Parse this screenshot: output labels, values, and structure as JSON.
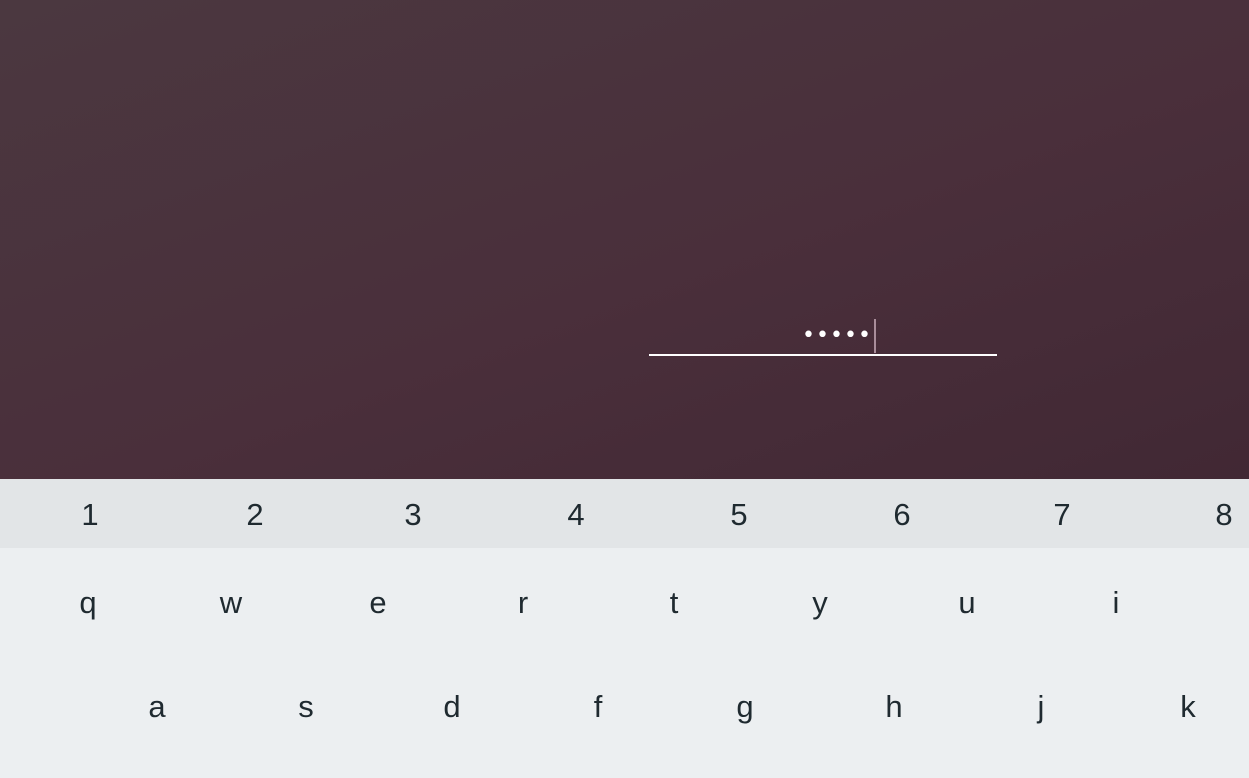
{
  "pin_entry": {
    "masked_value": "•••••"
  },
  "keyboard": {
    "number_row": [
      "1",
      "2",
      "3",
      "4",
      "5",
      "6",
      "7",
      "8"
    ],
    "row_q": [
      "q",
      "w",
      "e",
      "r",
      "t",
      "y",
      "u",
      "i"
    ],
    "row_a": [
      "a",
      "s",
      "d",
      "f",
      "g",
      "h",
      "j",
      "k"
    ]
  },
  "colors": {
    "background": "#4a2f3b",
    "keyboard": "#eceff1",
    "number_row": "#e2e5e7",
    "key_text": "#1f2a30",
    "underline": "#ffffff"
  }
}
